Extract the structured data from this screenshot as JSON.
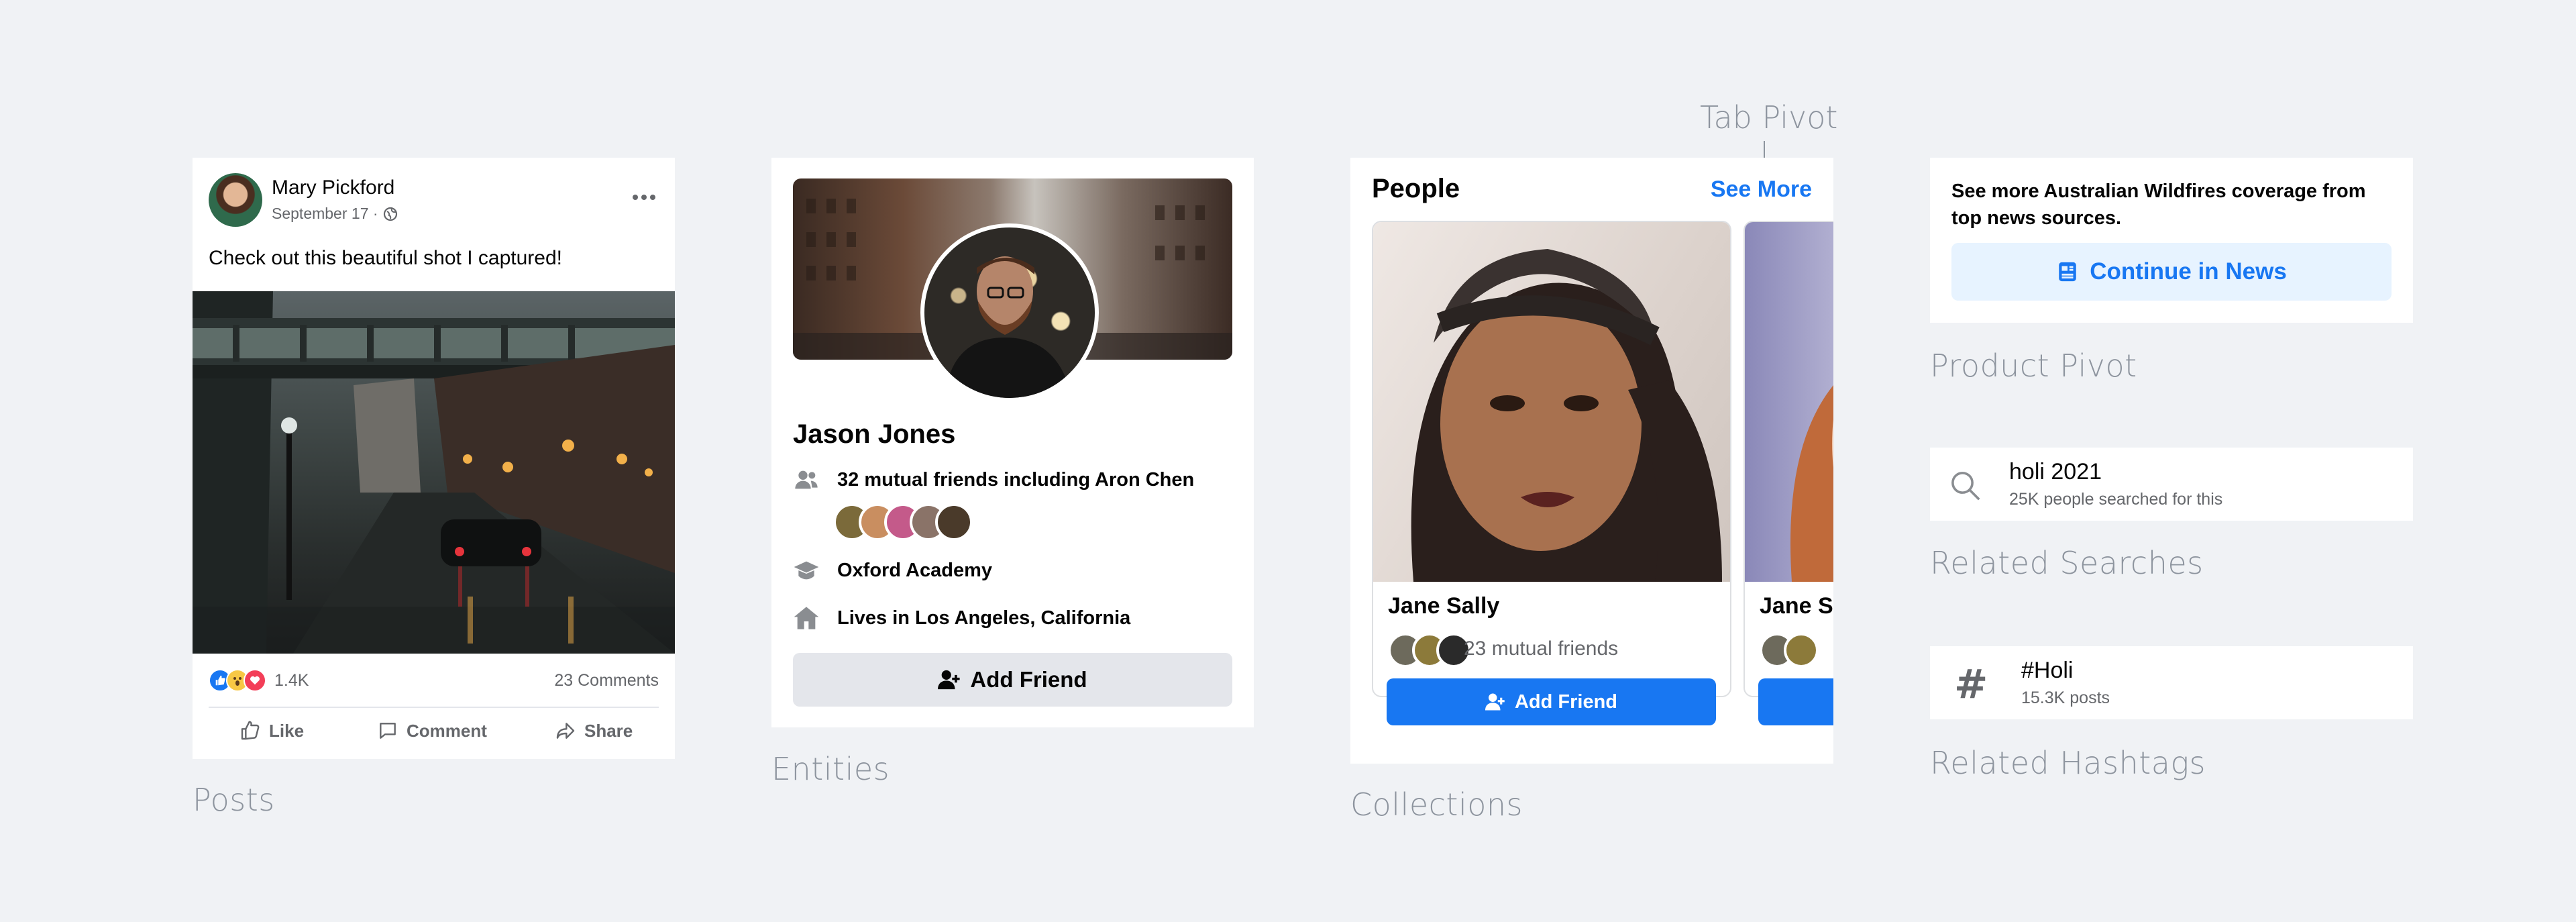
{
  "posts": {
    "author": "Mary Pickford",
    "date": "September 17 ·",
    "text": "Check out this beautiful shot I captured!",
    "reactions_count": "1.4K",
    "comments_count": "23 Comments",
    "actions": {
      "like": "Like",
      "comment": "Comment",
      "share": "Share"
    },
    "caption": "Posts"
  },
  "entities": {
    "name": "Jason Jones",
    "mutual": "32 mutual friends including Aron Chen",
    "school": "Oxford Academy",
    "location": "Lives in Los Angeles, California",
    "button": "Add Friend",
    "caption": "Entities"
  },
  "collections": {
    "title": "People",
    "see_more": "See More",
    "tab_pivot_label": "Tab Pivot",
    "cards": [
      {
        "name": "Jane Sally",
        "mutual": "23 mutual friends",
        "button": "Add Friend"
      },
      {
        "name": "Jane Sa"
      }
    ],
    "caption": "Collections"
  },
  "product_pivot": {
    "text": "See more Australian Wildfires coverage from top news sources.",
    "button": "Continue in News",
    "caption": "Product Pivot"
  },
  "related_searches": {
    "query": "holi 2021",
    "sub": "25K people searched for this",
    "caption": "Related Searches"
  },
  "related_hashtags": {
    "tag": "#Holi",
    "sub": "15.3K posts",
    "caption": "Related Hashtags"
  },
  "colors": {
    "background": "#f0f2f5",
    "brand_blue": "#1877f2",
    "caption_grey": "#8d949e"
  }
}
